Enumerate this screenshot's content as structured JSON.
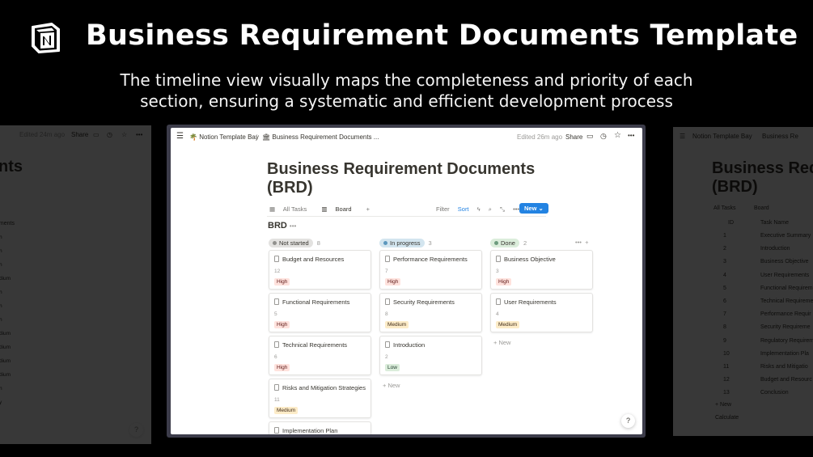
{
  "hero": {
    "title": "Business Requirement Documents Template",
    "subtitle_line1": "The timeline view visually maps the completeness and priority of each",
    "subtitle_line2": "section, ensuring a systematic and efficient development process"
  },
  "colors": {
    "accent": "#2383e2",
    "high": "#ffe2dd",
    "medium": "#fdecc8",
    "low": "#dbeddb",
    "not_started_dot": "#91918e",
    "in_progress_dot": "#5b97bd",
    "done_dot": "#6c9b7d"
  },
  "main": {
    "breadcrumb": {
      "workspace": "Notion Template Bay",
      "page": "Business Requirement Documents ...",
      "separator": "/"
    },
    "topbar": {
      "edited": "Edited 26m ago",
      "share": "Share"
    },
    "title_line1": "Business Requirement Documents",
    "title_line2": "(BRD)",
    "views": {
      "all_tasks": "All Tasks",
      "board": "Board",
      "add": "+"
    },
    "toolbar": {
      "filter": "Filter",
      "sort": "Sort",
      "new": "New"
    },
    "database_title": "BRD",
    "add_new": "New",
    "help": "?",
    "groups": [
      {
        "label": "Not started",
        "count": "8",
        "cards": [
          {
            "title": "Budget and Resources",
            "number": "12",
            "priority": "High"
          },
          {
            "title": "Functional Requirements",
            "number": "5",
            "priority": "High"
          },
          {
            "title": "Technical Requirements",
            "number": "6",
            "priority": "High"
          },
          {
            "title": "Risks and Mitigation Strategies",
            "number": "11",
            "priority": "Medium"
          },
          {
            "title": "Implementation Plan",
            "number": "",
            "priority": ""
          }
        ]
      },
      {
        "label": "In progress",
        "count": "3",
        "cards": [
          {
            "title": "Performance Requirements",
            "number": "7",
            "priority": "High"
          },
          {
            "title": "Security Requirements",
            "number": "8",
            "priority": "Medium"
          },
          {
            "title": "Introduction",
            "number": "2",
            "priority": "Low"
          }
        ]
      },
      {
        "label": "Done",
        "count": "2",
        "cards": [
          {
            "title": "Business Objective",
            "number": "3",
            "priority": "High"
          },
          {
            "title": "User Requirements",
            "number": "4",
            "priority": "Medium"
          }
        ]
      }
    ]
  },
  "left_window": {
    "edited": "Edited 24m ago",
    "share": "Share",
    "title_fragment": "nts",
    "column_fragment": "nments",
    "help": "?",
    "tags": [
      "h",
      "h",
      "h",
      "dium",
      "h",
      "h",
      "h",
      "dium",
      "dium",
      "dium",
      "dium",
      "h",
      "y"
    ]
  },
  "right_window": {
    "workspace": "Notion Template Bay",
    "page": "Business Re",
    "title_line1": "Business Requ",
    "title_line2": "(BRD)",
    "views": {
      "all_tasks": "All Tasks",
      "board": "Board"
    },
    "columns": {
      "id": "ID",
      "name": "Task Name"
    },
    "rows": [
      {
        "id": "1",
        "name": "Executive Summary"
      },
      {
        "id": "2",
        "name": "Introduction"
      },
      {
        "id": "3",
        "name": "Business Objective"
      },
      {
        "id": "4",
        "name": "User Requirements"
      },
      {
        "id": "5",
        "name": "Functional Requireme"
      },
      {
        "id": "6",
        "name": "Technical Requireme"
      },
      {
        "id": "7",
        "name": "Performance Requir"
      },
      {
        "id": "8",
        "name": "Security Requireme"
      },
      {
        "id": "9",
        "name": "Regulatory Requirem"
      },
      {
        "id": "10",
        "name": "Implementation Pla"
      },
      {
        "id": "11",
        "name": "Risks and Mitigatio"
      },
      {
        "id": "12",
        "name": "Budget and Resourc"
      },
      {
        "id": "13",
        "name": "Conclusion"
      }
    ],
    "new": "New",
    "calculate": "Calculate"
  }
}
